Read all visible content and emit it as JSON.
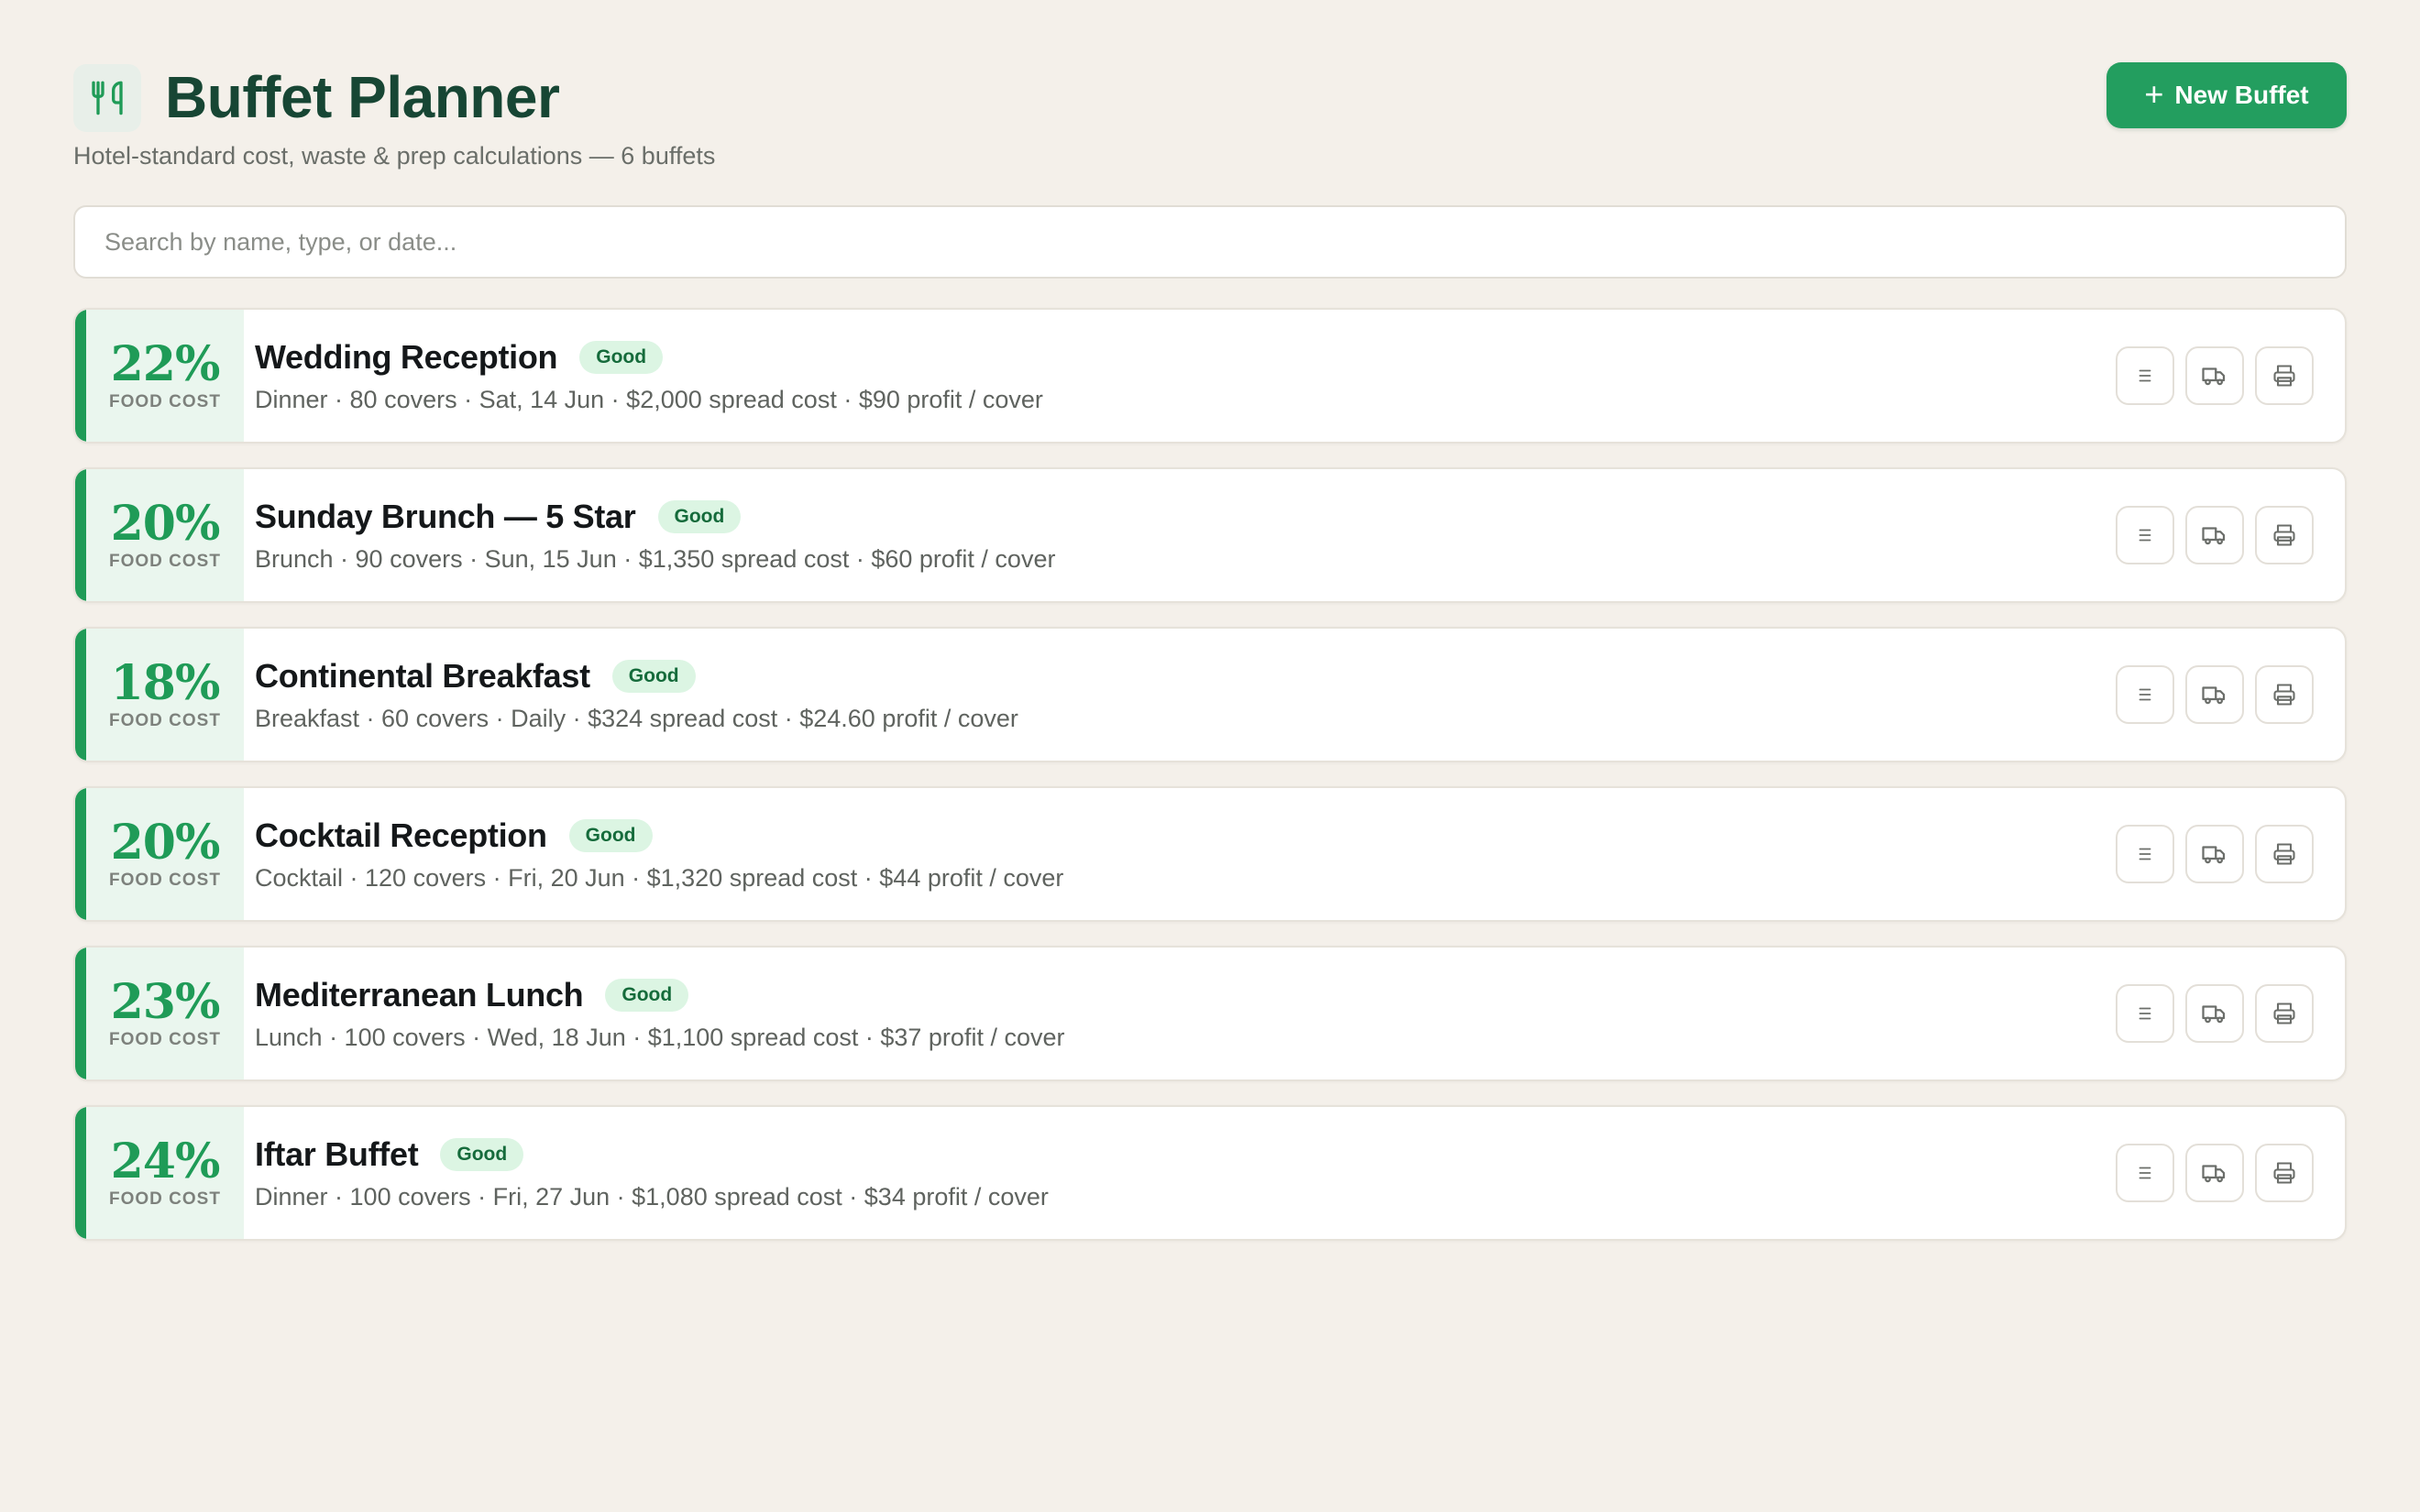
{
  "header": {
    "title": "Buffet Planner",
    "subtitle": "Hotel-standard cost, waste & prep calculations — 6 buffets",
    "new_button_label": "New Buffet",
    "logo_icon": "utensils-icon"
  },
  "search": {
    "placeholder": "Search by name, type, or date...",
    "value": ""
  },
  "colors": {
    "accent_green": "#1f9b57",
    "button_green": "#239e5f",
    "title_green": "#174634",
    "background": "#f4f0ea"
  },
  "buffets": [
    {
      "food_cost": "22%",
      "food_cost_label": "FOOD COST",
      "name": "Wedding Reception",
      "status": "Good",
      "meta": "Dinner · 80 covers · Sat, 14 Jun · $2,000 spread cost · $90 profit / cover"
    },
    {
      "food_cost": "20%",
      "food_cost_label": "FOOD COST",
      "name": "Sunday Brunch — 5 Star",
      "status": "Good",
      "meta": "Brunch · 90 covers · Sun, 15 Jun · $1,350 spread cost · $60 profit / cover"
    },
    {
      "food_cost": "18%",
      "food_cost_label": "FOOD COST",
      "name": "Continental Breakfast",
      "status": "Good",
      "meta": "Breakfast · 60 covers · Daily · $324 spread cost · $24.60 profit / cover"
    },
    {
      "food_cost": "20%",
      "food_cost_label": "FOOD COST",
      "name": "Cocktail Reception",
      "status": "Good",
      "meta": "Cocktail · 120 covers · Fri, 20 Jun · $1,320 spread cost · $44 profit / cover"
    },
    {
      "food_cost": "23%",
      "food_cost_label": "FOOD COST",
      "name": "Mediterranean Lunch",
      "status": "Good",
      "meta": "Lunch · 100 covers · Wed, 18 Jun · $1,100 spread cost · $37 profit / cover"
    },
    {
      "food_cost": "24%",
      "food_cost_label": "FOOD COST",
      "name": "Iftar Buffet",
      "status": "Good",
      "meta": "Dinner · 100 covers · Fri, 27 Jun · $1,080 spread cost · $34 profit / cover"
    }
  ],
  "row_actions": [
    "list-icon",
    "truck-icon",
    "printer-icon"
  ]
}
